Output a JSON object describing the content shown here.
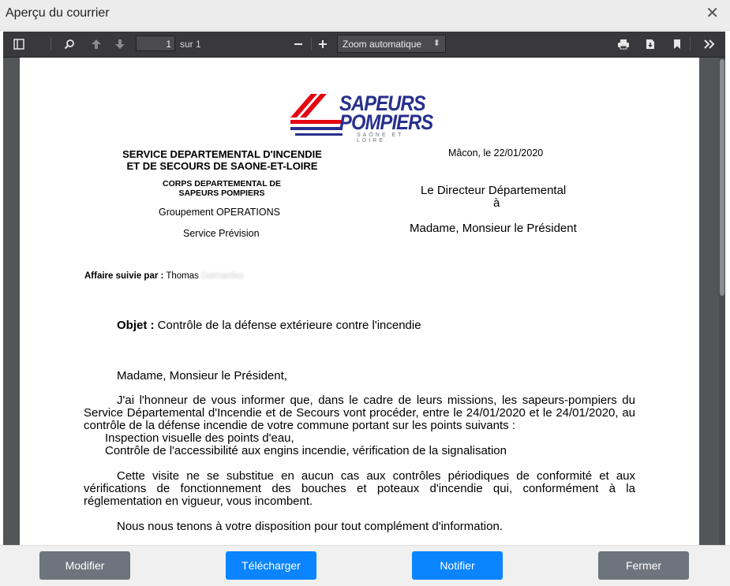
{
  "dialog": {
    "title": "Aperçu du courrier",
    "close_glyph": "✕"
  },
  "toolbar": {
    "page_current": "1",
    "page_of": "sur 1",
    "zoom": "Zoom automatique",
    "icons": [
      "sidebar-toggle-icon",
      "search-icon",
      "previous-page-icon",
      "next-page-icon",
      "zoom-out-icon",
      "zoom-in-icon",
      "print-icon",
      "download-icon",
      "bookmark-icon",
      "tools-icon"
    ]
  },
  "letter": {
    "logo_line1": "SAPEURS",
    "logo_line2": "POMPIERS",
    "logo_sub": "SAÔNE ET LOIRE",
    "org_line1": "SERVICE DEPARTEMENTAL D'INCENDIE",
    "org_line2": "ET DE SECOURS DE SAONE-ET-LOIRE",
    "corps_line1": "CORPS DEPARTEMENTAL DE",
    "corps_line2": "SAPEURS POMPIERS",
    "groupement": "Groupement OPERATIONS",
    "service": "Service Prévision",
    "place_date": "Mâcon, le 22/01/2020",
    "sender": "Le Directeur Départemental",
    "to": "à",
    "recipient": "Madame, Monsieur le Président",
    "followed_label": "Affaire suivie par :",
    "followed_name": "Thomas",
    "followed_surname": "Gamardes",
    "object_label": "Objet :",
    "object_text": "Contrôle de la défense extérieure contre l'incendie",
    "salutation": "Madame, Monsieur le Président,",
    "para1": "J'ai l'honneur de vous informer que, dans le cadre de leurs missions, les sapeurs-pompiers du Service Départemental d'Incendie et de Secours vont procéder, entre le 24/01/2020 et le 24/01/2020, au contrôle de la défense incendie de votre commune portant sur les points suivants :",
    "bullet1": "Inspection visuelle des points d'eau,",
    "bullet2": "Contrôle de l'accessibilité aux engins incendie, vérification de la signalisation",
    "para2": "Cette visite ne se substitue en aucun cas aux contrôles périodiques de conformité et aux vérifications de fonctionnement des bouches et poteaux d'incendie qui, conformément à la réglementation en vigueur, vous incombent.",
    "para3": "Nous nous tenons à votre disposition pour tout complément d'information."
  },
  "footer": {
    "modify": "Modifier",
    "download": "Télécharger",
    "notify": "Notifier",
    "close": "Fermer"
  },
  "colors": {
    "primary": "#0a84ff",
    "secondary": "#6c757d",
    "logo_blue": "#27308c",
    "logo_red": "#e30613"
  }
}
